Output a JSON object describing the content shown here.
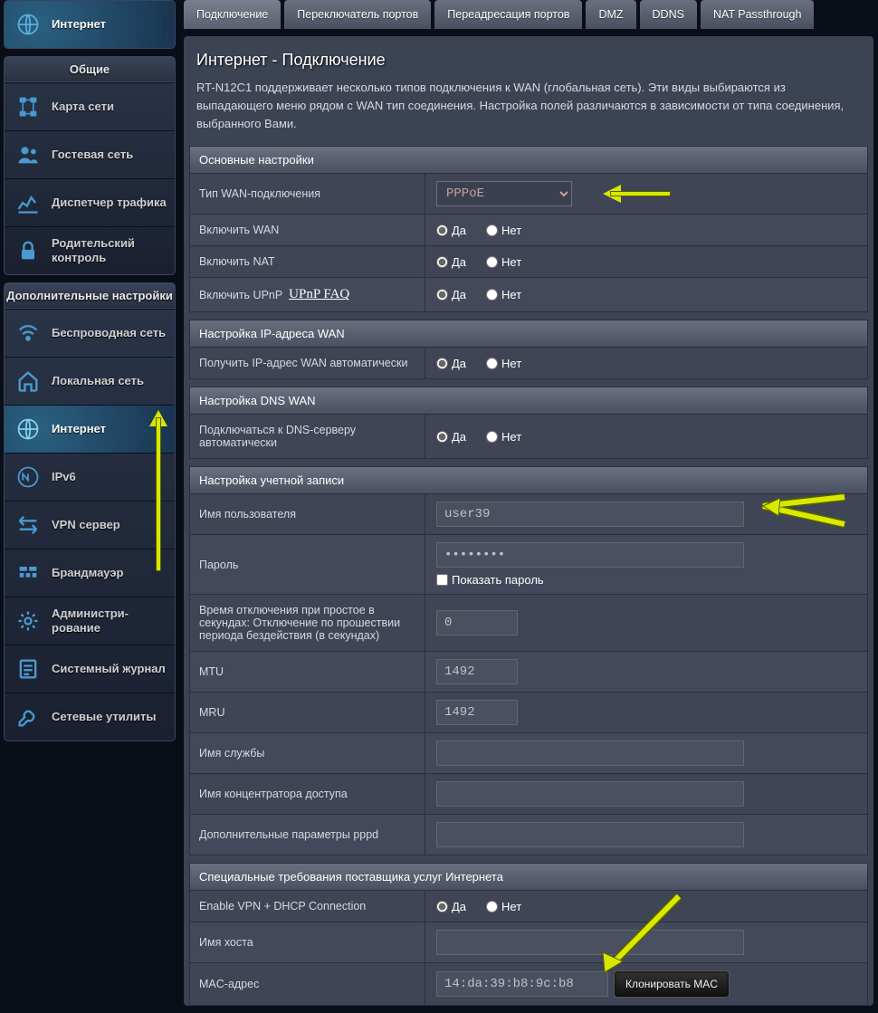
{
  "sidebar": {
    "top_active": "Интернет",
    "general_header": "Общие",
    "general_items": [
      {
        "label": "Карта сети"
      },
      {
        "label": "Гостевая сеть"
      },
      {
        "label": "Диспетчер трафика"
      },
      {
        "label": "Родительский контроль"
      }
    ],
    "advanced_header": "Дополнительные настройки",
    "advanced_items": [
      {
        "label": "Беспроводная сеть"
      },
      {
        "label": "Локальная сеть"
      },
      {
        "label": "Интернет"
      },
      {
        "label": "IPv6"
      },
      {
        "label": "VPN сервер"
      },
      {
        "label": "Брандмауэр"
      },
      {
        "label": "Администри-рование"
      },
      {
        "label": "Системный журнал"
      },
      {
        "label": "Сетевые утилиты"
      }
    ]
  },
  "tabs": [
    "Подключение",
    "Переключатель портов",
    "Переадресация портов",
    "DMZ",
    "DDNS",
    "NAT Passthrough"
  ],
  "page": {
    "title": "Интернет - Подключение",
    "desc": "RT-N12C1 поддерживает несколько типов подключения к WAN (глобальная сеть). Эти виды выбираются из выпадающего меню рядом с WAN тип соединения. Настройка полей различаются в зависимости от типа соединения, выбранного Вами."
  },
  "groups": {
    "basic": {
      "title": "Основные настройки",
      "wan_type_label": "Тип WAN-подключения",
      "wan_type_value": "PPPoE",
      "enable_wan": "Включить WAN",
      "enable_nat": "Включить NAT",
      "enable_upnp": "Включить UPnP",
      "upnp_faq": "UPnP FAQ"
    },
    "wan_ip": {
      "title": "Настройка IP-адреса WAN",
      "auto_label": "Получить IP-адрес WAN автоматически"
    },
    "dns": {
      "title": "Настройка DNS WAN",
      "auto_label": "Подключаться к DNS-серверу автоматически"
    },
    "account": {
      "title": "Настройка учетной записи",
      "user_label": "Имя пользователя",
      "user_value": "user39",
      "pass_label": "Пароль",
      "pass_value": "••••••••",
      "show_pass": "Показать пароль",
      "idle_label": "Время отключения при простое в секундах: Отключение по прошествии периода бездействия (в секундах)",
      "idle_value": "0",
      "mtu_label": "MTU",
      "mtu_value": "1492",
      "mru_label": "MRU",
      "mru_value": "1492",
      "service_label": "Имя службы",
      "ac_label": "Имя концентратора доступа",
      "pppd_label": "Дополнительные параметры pppd"
    },
    "isp": {
      "title": "Специальные требования поставщика услуг Интернета",
      "vpn_dhcp_label": "Enable VPN + DHCP Connection",
      "hostname_label": "Имя хоста",
      "mac_label": "MAC-адрес",
      "mac_value": "14:da:39:b8:9c:b8",
      "clone_btn": "Клонировать MAC"
    }
  },
  "opts": {
    "yes": "Да",
    "no": "Нет"
  }
}
